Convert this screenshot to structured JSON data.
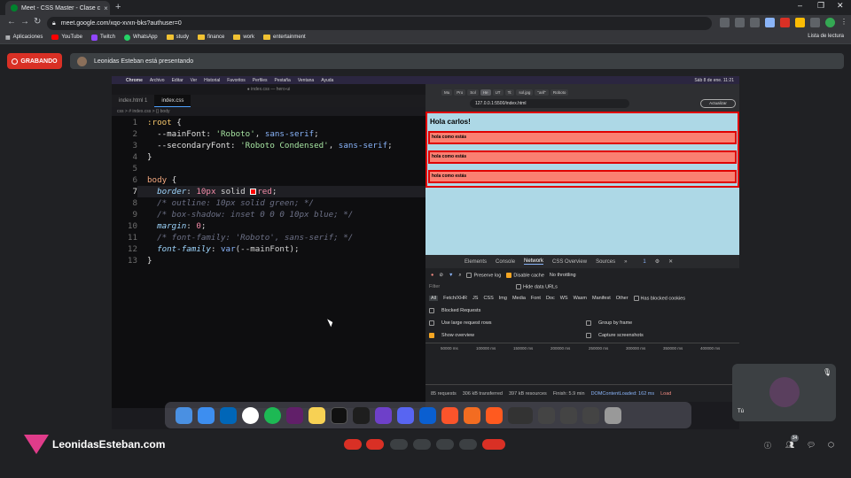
{
  "browser": {
    "tab_title": "Meet - CSS Master - Clase c",
    "url": "meet.google.com/xqo-xvxn-bks?authuser=0",
    "bookmarks": [
      "Aplicaciones",
      "YouTube",
      "Twitch",
      "WhatsApp",
      "study",
      "finance",
      "work",
      "entertainment"
    ],
    "reading_list": "Lista de lectura"
  },
  "meet": {
    "recording_label": "GRABANDO",
    "presenting_text": "Leonidas Esteban está presentando",
    "self_label": "Tú",
    "logo_text": "LeonidasEsteban.com",
    "participants_count": "34"
  },
  "mac_menu": [
    "Chrome",
    "Archivo",
    "Editar",
    "Ver",
    "Historial",
    "Favoritos",
    "Perfiles",
    "Pestaña",
    "Ventana",
    "Ayuda"
  ],
  "mac_clock": "Sáb 8 de ene. 11:21",
  "editor": {
    "window_title": "● index.css — hero-ui",
    "tabs": [
      "index.html 1",
      "index.css"
    ],
    "breadcrumb": "css > # index.css > {} body",
    "line_numbers": [
      "1",
      "2",
      "3",
      "4",
      "5",
      "6",
      "7",
      "8",
      "9",
      "10",
      "11",
      "12",
      "13"
    ]
  },
  "inner_browser": {
    "tabs": [
      "Mu",
      "Pro",
      "Sol",
      "He",
      "UT",
      "Ti:",
      "sol.jpg",
      "\"arif\"",
      "Roboto"
    ],
    "url": "127.0.0.1:5500/index.html",
    "update_button": "Actualizar",
    "h1": "Hola carlos!",
    "paragraphs": [
      "hola como estás",
      "hola como estás",
      "hola como estás"
    ]
  },
  "devtools": {
    "tabs": [
      "Elements",
      "Console",
      "Network",
      "CSS Overview",
      "Sources",
      "»"
    ],
    "issues_badge": "1",
    "preserve_log": "Preserve log",
    "disable_cache": "Disable cache",
    "throttling": "No throttling",
    "filter_placeholder": "Filter",
    "hide_data_urls": "Hide data URLs",
    "types": [
      "All",
      "Fetch/XHR",
      "JS",
      "CSS",
      "Img",
      "Media",
      "Font",
      "Doc",
      "WS",
      "Wasm",
      "Manifest",
      "Other"
    ],
    "has_blocked": "Has blocked cookies",
    "blocked_requests": "Blocked Requests",
    "large_rows": "Use large request rows",
    "group_frame": "Group by frame",
    "show_overview": "Show overview",
    "capture_screens": "Capture screenshots",
    "timeline": [
      "50000 ms",
      "100000 ms",
      "150000 ms",
      "200000 ms",
      "250000 ms",
      "300000 ms",
      "350000 ms",
      "400000 ms"
    ],
    "status": [
      "85 requests",
      "306 kB transferred",
      "397 kB resources",
      "Finish: 5.9 min",
      "DOMContentLoaded: 162 ms",
      "Load"
    ]
  },
  "colors": {
    "record": "#d93025",
    "page_bg": "#add8e6",
    "box": "#fa8072",
    "border": "#e00000"
  }
}
